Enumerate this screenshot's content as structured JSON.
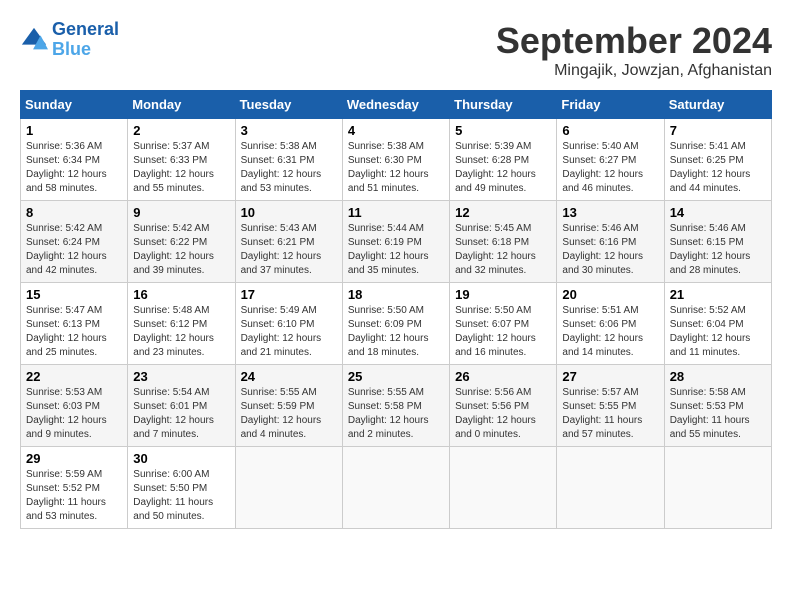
{
  "header": {
    "logo_line1": "General",
    "logo_line2": "Blue",
    "month": "September 2024",
    "location": "Mingajik, Jowzjan, Afghanistan"
  },
  "columns": [
    "Sunday",
    "Monday",
    "Tuesday",
    "Wednesday",
    "Thursday",
    "Friday",
    "Saturday"
  ],
  "weeks": [
    [
      {
        "day": "1",
        "rise": "5:36 AM",
        "set": "6:34 PM",
        "hours": "12 hours",
        "mins": "58 minutes"
      },
      {
        "day": "2",
        "rise": "5:37 AM",
        "set": "6:33 PM",
        "hours": "12 hours",
        "mins": "55 minutes"
      },
      {
        "day": "3",
        "rise": "5:38 AM",
        "set": "6:31 PM",
        "hours": "12 hours",
        "mins": "53 minutes"
      },
      {
        "day": "4",
        "rise": "5:38 AM",
        "set": "6:30 PM",
        "hours": "12 hours",
        "mins": "51 minutes"
      },
      {
        "day": "5",
        "rise": "5:39 AM",
        "set": "6:28 PM",
        "hours": "12 hours",
        "mins": "49 minutes"
      },
      {
        "day": "6",
        "rise": "5:40 AM",
        "set": "6:27 PM",
        "hours": "12 hours",
        "mins": "46 minutes"
      },
      {
        "day": "7",
        "rise": "5:41 AM",
        "set": "6:25 PM",
        "hours": "12 hours",
        "mins": "44 minutes"
      }
    ],
    [
      {
        "day": "8",
        "rise": "5:42 AM",
        "set": "6:24 PM",
        "hours": "12 hours",
        "mins": "42 minutes"
      },
      {
        "day": "9",
        "rise": "5:42 AM",
        "set": "6:22 PM",
        "hours": "12 hours",
        "mins": "39 minutes"
      },
      {
        "day": "10",
        "rise": "5:43 AM",
        "set": "6:21 PM",
        "hours": "12 hours",
        "mins": "37 minutes"
      },
      {
        "day": "11",
        "rise": "5:44 AM",
        "set": "6:19 PM",
        "hours": "12 hours",
        "mins": "35 minutes"
      },
      {
        "day": "12",
        "rise": "5:45 AM",
        "set": "6:18 PM",
        "hours": "12 hours",
        "mins": "32 minutes"
      },
      {
        "day": "13",
        "rise": "5:46 AM",
        "set": "6:16 PM",
        "hours": "12 hours",
        "mins": "30 minutes"
      },
      {
        "day": "14",
        "rise": "5:46 AM",
        "set": "6:15 PM",
        "hours": "12 hours",
        "mins": "28 minutes"
      }
    ],
    [
      {
        "day": "15",
        "rise": "5:47 AM",
        "set": "6:13 PM",
        "hours": "12 hours",
        "mins": "25 minutes"
      },
      {
        "day": "16",
        "rise": "5:48 AM",
        "set": "6:12 PM",
        "hours": "12 hours",
        "mins": "23 minutes"
      },
      {
        "day": "17",
        "rise": "5:49 AM",
        "set": "6:10 PM",
        "hours": "12 hours",
        "mins": "21 minutes"
      },
      {
        "day": "18",
        "rise": "5:50 AM",
        "set": "6:09 PM",
        "hours": "12 hours",
        "mins": "18 minutes"
      },
      {
        "day": "19",
        "rise": "5:50 AM",
        "set": "6:07 PM",
        "hours": "12 hours",
        "mins": "16 minutes"
      },
      {
        "day": "20",
        "rise": "5:51 AM",
        "set": "6:06 PM",
        "hours": "12 hours",
        "mins": "14 minutes"
      },
      {
        "day": "21",
        "rise": "5:52 AM",
        "set": "6:04 PM",
        "hours": "12 hours",
        "mins": "11 minutes"
      }
    ],
    [
      {
        "day": "22",
        "rise": "5:53 AM",
        "set": "6:03 PM",
        "hours": "12 hours",
        "mins": "9 minutes"
      },
      {
        "day": "23",
        "rise": "5:54 AM",
        "set": "6:01 PM",
        "hours": "12 hours",
        "mins": "7 minutes"
      },
      {
        "day": "24",
        "rise": "5:55 AM",
        "set": "5:59 PM",
        "hours": "12 hours",
        "mins": "4 minutes"
      },
      {
        "day": "25",
        "rise": "5:55 AM",
        "set": "5:58 PM",
        "hours": "12 hours",
        "mins": "2 minutes"
      },
      {
        "day": "26",
        "rise": "5:56 AM",
        "set": "5:56 PM",
        "hours": "12 hours",
        "mins": "0 minutes"
      },
      {
        "day": "27",
        "rise": "5:57 AM",
        "set": "5:55 PM",
        "hours": "11 hours",
        "mins": "57 minutes"
      },
      {
        "day": "28",
        "rise": "5:58 AM",
        "set": "5:53 PM",
        "hours": "11 hours",
        "mins": "55 minutes"
      }
    ],
    [
      {
        "day": "29",
        "rise": "5:59 AM",
        "set": "5:52 PM",
        "hours": "11 hours",
        "mins": "53 minutes"
      },
      {
        "day": "30",
        "rise": "6:00 AM",
        "set": "5:50 PM",
        "hours": "11 hours",
        "mins": "50 minutes"
      },
      null,
      null,
      null,
      null,
      null
    ]
  ]
}
